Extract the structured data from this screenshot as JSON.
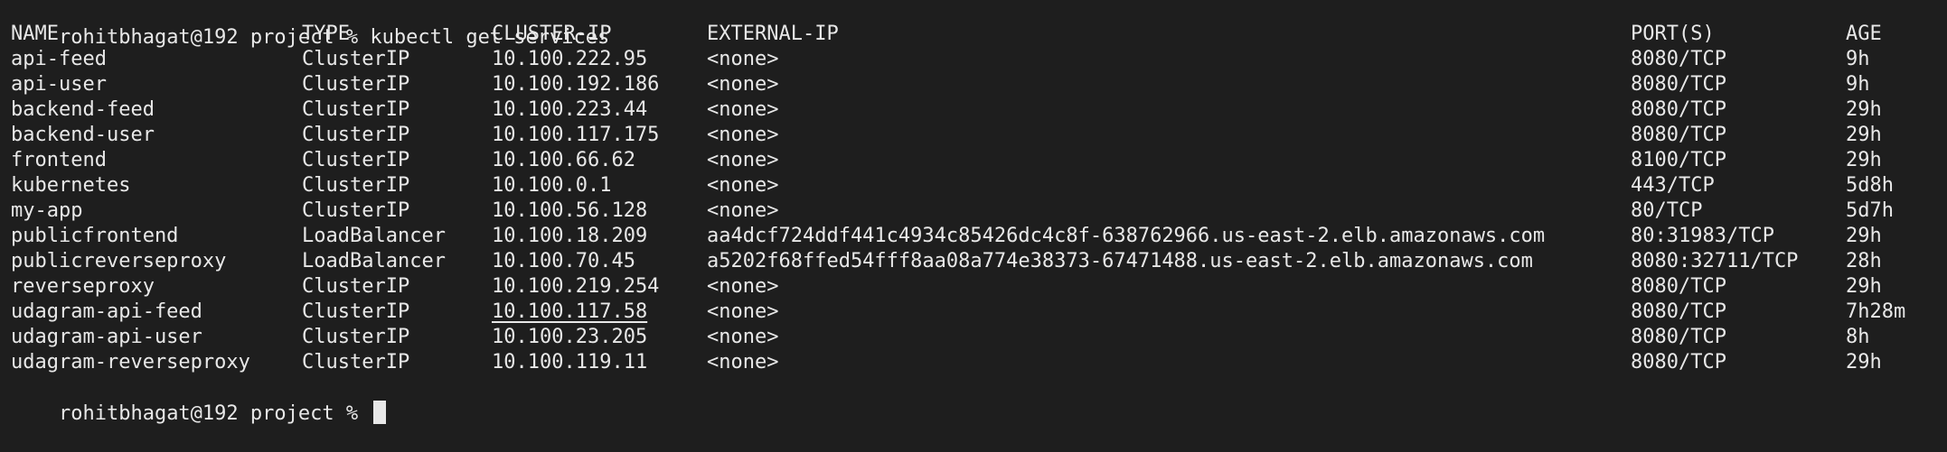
{
  "terminal": {
    "prompt": "rohitbhagat@192 project % ",
    "command": "kubectl get services",
    "headers": {
      "name": "NAME",
      "type": "TYPE",
      "cluster_ip": "CLUSTER-IP",
      "external_ip": "EXTERNAL-IP",
      "ports": "PORT(S)",
      "age": "AGE"
    },
    "rows": [
      {
        "name": "api-feed",
        "type": "ClusterIP",
        "cluster_ip": "10.100.222.95",
        "external_ip": "<none>",
        "ports": "8080/TCP",
        "age": "9h"
      },
      {
        "name": "api-user",
        "type": "ClusterIP",
        "cluster_ip": "10.100.192.186",
        "external_ip": "<none>",
        "ports": "8080/TCP",
        "age": "9h"
      },
      {
        "name": "backend-feed",
        "type": "ClusterIP",
        "cluster_ip": "10.100.223.44",
        "external_ip": "<none>",
        "ports": "8080/TCP",
        "age": "29h"
      },
      {
        "name": "backend-user",
        "type": "ClusterIP",
        "cluster_ip": "10.100.117.175",
        "external_ip": "<none>",
        "ports": "8080/TCP",
        "age": "29h"
      },
      {
        "name": "frontend",
        "type": "ClusterIP",
        "cluster_ip": "10.100.66.62",
        "external_ip": "<none>",
        "ports": "8100/TCP",
        "age": "29h"
      },
      {
        "name": "kubernetes",
        "type": "ClusterIP",
        "cluster_ip": "10.100.0.1",
        "external_ip": "<none>",
        "ports": "443/TCP",
        "age": "5d8h"
      },
      {
        "name": "my-app",
        "type": "ClusterIP",
        "cluster_ip": "10.100.56.128",
        "external_ip": "<none>",
        "ports": "80/TCP",
        "age": "5d7h"
      },
      {
        "name": "publicfrontend",
        "type": "LoadBalancer",
        "cluster_ip": "10.100.18.209",
        "external_ip": "aa4dcf724ddf441c4934c85426dc4c8f-638762966.us-east-2.elb.amazonaws.com",
        "ports": "80:31983/TCP",
        "age": "29h"
      },
      {
        "name": "publicreverseproxy",
        "type": "LoadBalancer",
        "cluster_ip": "10.100.70.45",
        "external_ip": "a5202f68ffed54fff8aa08a774e38373-67471488.us-east-2.elb.amazonaws.com",
        "ports": "8080:32711/TCP",
        "age": "28h"
      },
      {
        "name": "reverseproxy",
        "type": "ClusterIP",
        "cluster_ip": "10.100.219.254",
        "external_ip": "<none>",
        "ports": "8080/TCP",
        "age": "29h"
      },
      {
        "name": "udagram-api-feed",
        "type": "ClusterIP",
        "cluster_ip": "10.100.117.58",
        "external_ip": "<none>",
        "ports": "8080/TCP",
        "age": "7h28m"
      },
      {
        "name": "udagram-api-user",
        "type": "ClusterIP",
        "cluster_ip": "10.100.23.205",
        "external_ip": "<none>",
        "ports": "8080/TCP",
        "age": "8h"
      },
      {
        "name": "udagram-reverseproxy",
        "type": "ClusterIP",
        "cluster_ip": "10.100.119.11",
        "external_ip": "<none>",
        "ports": "8080/TCP",
        "age": "29h"
      }
    ],
    "final_prompt": "rohitbhagat@192 project % "
  }
}
